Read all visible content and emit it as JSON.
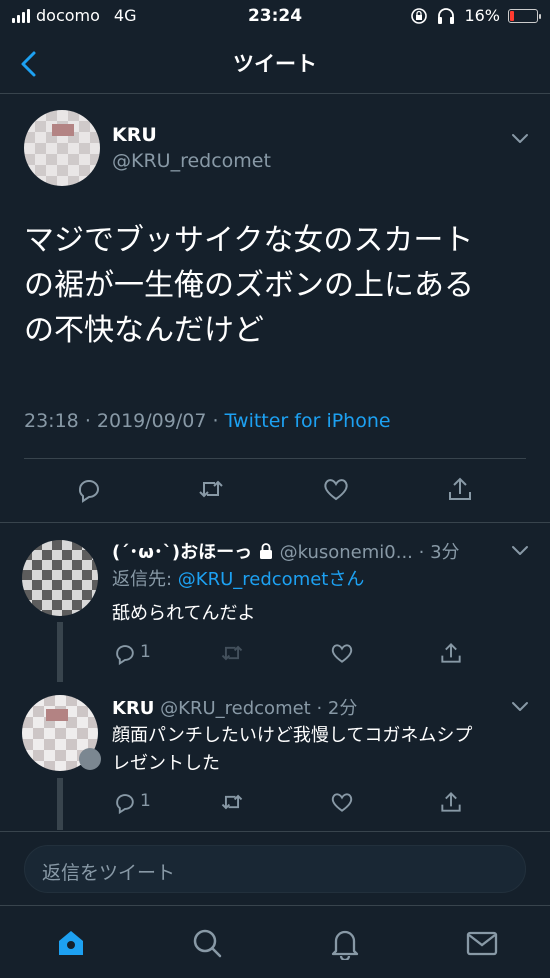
{
  "status": {
    "carrier": "docomo",
    "network": "4G",
    "time": "23:24",
    "battery": "16%",
    "battery_level": 0.16
  },
  "nav": {
    "title": "ツイート",
    "back_icon": "chevron-left-icon"
  },
  "tweet": {
    "name": "KRU",
    "handle": "@KRU_redcomet",
    "text_lines": [
      "マジでブッサイクな女のスカート",
      "の裾が一生俺のズボンの上にある",
      "の不快なんだけど"
    ],
    "time": "23:18",
    "date": "2019/09/07",
    "sep": "·",
    "source": "Twitter for iPhone"
  },
  "replies": [
    {
      "name": "(´･ω･`)おほーっ",
      "handle": "@kusonemi0...",
      "ago": "· 3分",
      "replying_to_label": "返信先: ",
      "replying_to": "@KRU_redcometさん",
      "text": "舐められてんだよ",
      "reply_count": "1"
    },
    {
      "name": "KRU",
      "handle": "@KRU_redcomet",
      "ago": "· 2分",
      "text_lines": [
        "顔面パンチしたいけど我慢してコガネムシプ",
        "レゼントした"
      ],
      "reply_count": "1"
    }
  ],
  "compose": {
    "placeholder": "返信をツイート"
  },
  "colors": {
    "background": "#15202b",
    "accent": "#1da1f2",
    "muted": "#8899a6",
    "border": "#38444d"
  },
  "tabs": [
    "home-icon",
    "search-icon",
    "notifications-icon",
    "messages-icon"
  ]
}
